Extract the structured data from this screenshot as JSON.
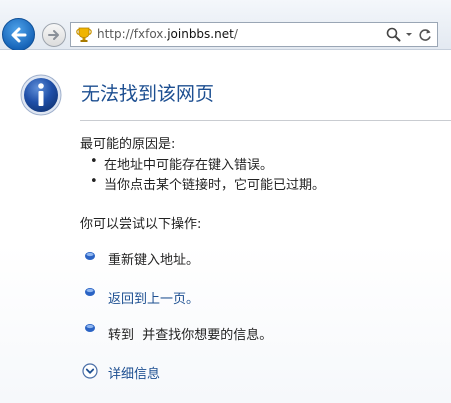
{
  "browser": {
    "address_prefix": "http://fxfox.",
    "address_host": "joinbbs.net",
    "address_suffix": "/"
  },
  "error_page": {
    "title": "无法找到该网页",
    "reasons_heading": "最可能的原因是:",
    "reasons": [
      "在地址中可能存在键入错误。",
      "当你点击某个链接时，它可能已过期。"
    ],
    "actions_heading": "你可以尝试以下操作:",
    "actions": [
      "重新键入地址。",
      "返回到上一页。",
      "转到  并查找你想要的信息。"
    ],
    "more_info": "详细信息"
  },
  "colors": {
    "title": "#1d4f91",
    "link": "#1d4f91",
    "back_button": "#1765b9"
  }
}
